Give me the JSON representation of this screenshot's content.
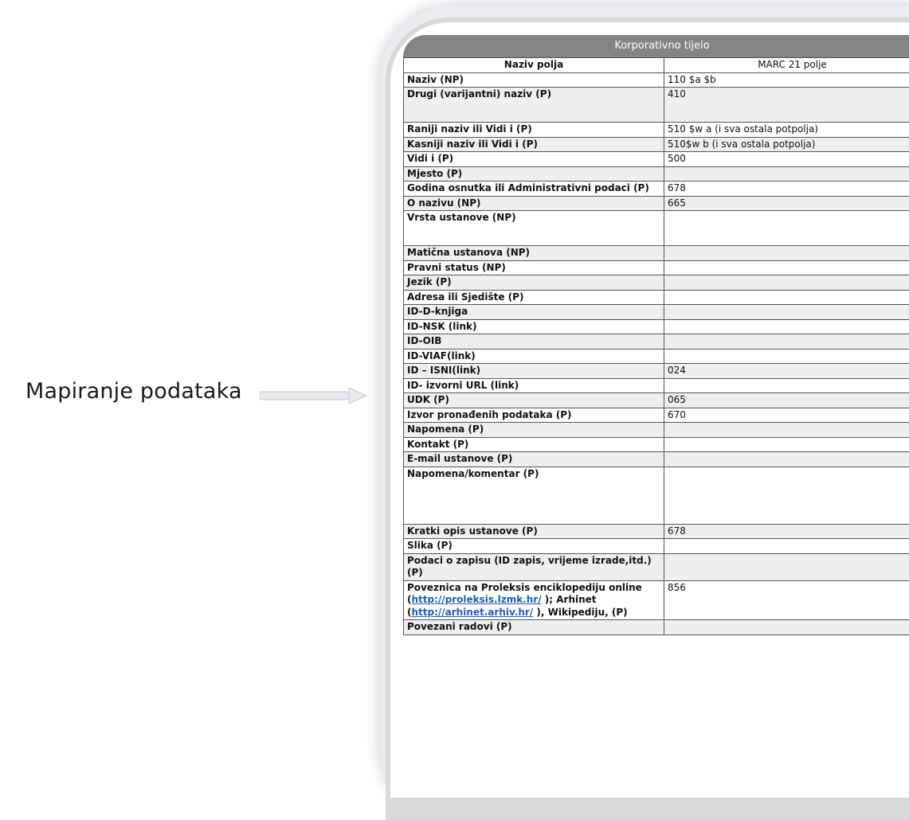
{
  "side_label": "Mapiranje podataka",
  "table": {
    "title": "Korporativno tijelo",
    "header": {
      "col1": "Naziv polja",
      "col2": "MARC 21 polje"
    },
    "rows": [
      {
        "field": "Naziv (NP)",
        "marc": "110 $a $b"
      },
      {
        "field": "Drugi (varijantni) naziv (P)",
        "marc": "410"
      },
      {
        "field": "Raniji naziv ili Vidi i  (P)",
        "marc": "510 $w a (i sva ostala potpolja)"
      },
      {
        "field": "Kasniji naziv ili Vidi i (P)",
        "marc": "510$w b (i sva ostala potpolja)"
      },
      {
        "field": "Vidi i  (P)",
        "marc": "500"
      },
      {
        "field": "Mjesto (P)",
        "marc": ""
      },
      {
        "field": "Godina osnutka ili Administrativni podaci (P)",
        "marc": "678"
      },
      {
        "field": "O nazivu (NP)",
        "marc": "665"
      },
      {
        "field": "Vrsta ustanove (NP)",
        "marc": ""
      },
      {
        "field": "Matična ustanova (NP)",
        "marc": ""
      },
      {
        "field": "Pravni status (NP)",
        "marc": ""
      },
      {
        "field": "Jezik (P)",
        "marc": ""
      },
      {
        "field": "Adresa ili Sjedište (P)",
        "marc": ""
      },
      {
        "field": "ID-D-knjiga",
        "marc": ""
      },
      {
        "field": "ID-NSK (link)",
        "marc": ""
      },
      {
        "field": "ID-OIB",
        "marc": ""
      },
      {
        "field": "ID-VIAF(link)",
        "marc": ""
      },
      {
        "field": "ID – ISNI(link)",
        "marc": "024"
      },
      {
        "field": "ID- izvorni URL (link)",
        "marc": ""
      },
      {
        "field": "UDK (P)",
        "marc": "065"
      },
      {
        "field": "Izvor pronađenih podataka (P)",
        "marc": "670"
      },
      {
        "field": "Napomena (P)",
        "marc": ""
      },
      {
        "field": "Kontakt (P)",
        "marc": ""
      },
      {
        "field": "E-mail ustanove (P)",
        "marc": ""
      },
      {
        "field": "Napomena/komentar  (P)",
        "marc": ""
      },
      {
        "field": "Kratki opis ustanove (P)",
        "marc": "678"
      },
      {
        "field": "Slika (P)",
        "marc": ""
      },
      {
        "field": "Podaci o zapisu (ID zapis, vrijeme izrade,itd.) (P)",
        "marc": ""
      },
      {
        "field": "Poveznica na Proleksis enciklopediju online",
        "marc": "856"
      },
      {
        "field": "Povezani radovi (P)",
        "marc": ""
      }
    ],
    "link_row": {
      "open1": "(",
      "link1": "http://proleksis.lzmk.hr/",
      "mid1": " ); Arhinet",
      "open2": "(",
      "link2": "http://arhinet.arhiv.hr/",
      "tail": " ), Wikipediju,  (P)"
    }
  }
}
